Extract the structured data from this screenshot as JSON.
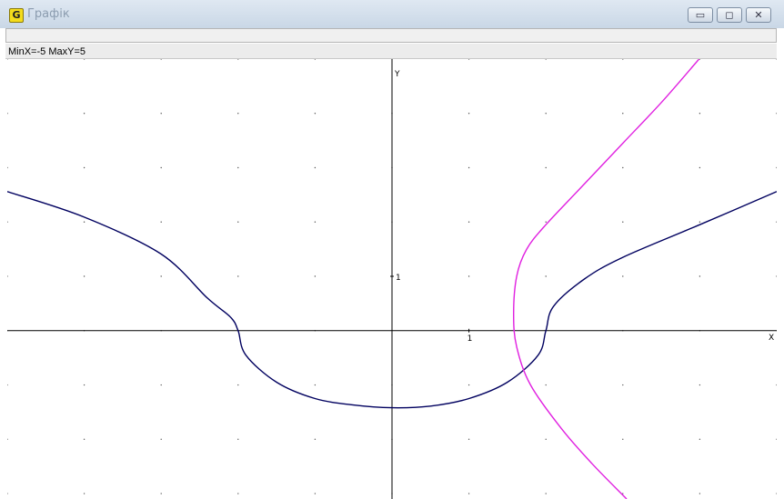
{
  "window": {
    "title": "Графік",
    "app_icon_letter": "G",
    "minimize_glyph": "▭",
    "maximize_glyph": "◻",
    "close_glyph": "✕"
  },
  "status": {
    "range_text": "MinX=-5  MaxY=5"
  },
  "chart_data": {
    "type": "line",
    "title": "",
    "xlabel": "X",
    "ylabel": "Y",
    "x_tick_labels": [
      "1"
    ],
    "y_tick_labels": [
      "1"
    ],
    "xlim": [
      -5,
      5
    ],
    "ylim": [
      -3.1,
      5
    ],
    "grid": "dotted",
    "series": [
      {
        "color": "#00005f",
        "points": [
          [
            -5,
            2.56
          ],
          [
            -4,
            2.09
          ],
          [
            -3,
            1.41
          ],
          [
            -2.4,
            0.6
          ],
          [
            -2.1,
            0.25
          ],
          [
            -2,
            0
          ],
          [
            -1.9,
            -0.45
          ],
          [
            -1.5,
            -0.95
          ],
          [
            -1,
            -1.25
          ],
          [
            -0.5,
            -1.37
          ],
          [
            0,
            -1.42
          ],
          [
            0.5,
            -1.39
          ],
          [
            1,
            -1.25
          ],
          [
            1.5,
            -0.95
          ],
          [
            1.9,
            -0.45
          ],
          [
            2,
            0
          ],
          [
            2.1,
            0.45
          ],
          [
            2.5,
            0.95
          ],
          [
            3,
            1.35
          ],
          [
            4,
            1.95
          ],
          [
            5,
            2.56
          ]
        ]
      },
      {
        "color": "#e020e0",
        "points": [
          [
            3.99,
            5
          ],
          [
            3.5,
            4.2
          ],
          [
            3,
            3.45
          ],
          [
            2.5,
            2.7
          ],
          [
            2,
            1.95
          ],
          [
            1.75,
            1.5
          ],
          [
            1.62,
            1.0
          ],
          [
            1.58,
            0.3
          ],
          [
            1.62,
            -0.3
          ],
          [
            1.8,
            -1.0
          ],
          [
            2.2,
            -1.8
          ],
          [
            2.6,
            -2.45
          ],
          [
            3.05,
            -3.1
          ]
        ]
      }
    ]
  }
}
